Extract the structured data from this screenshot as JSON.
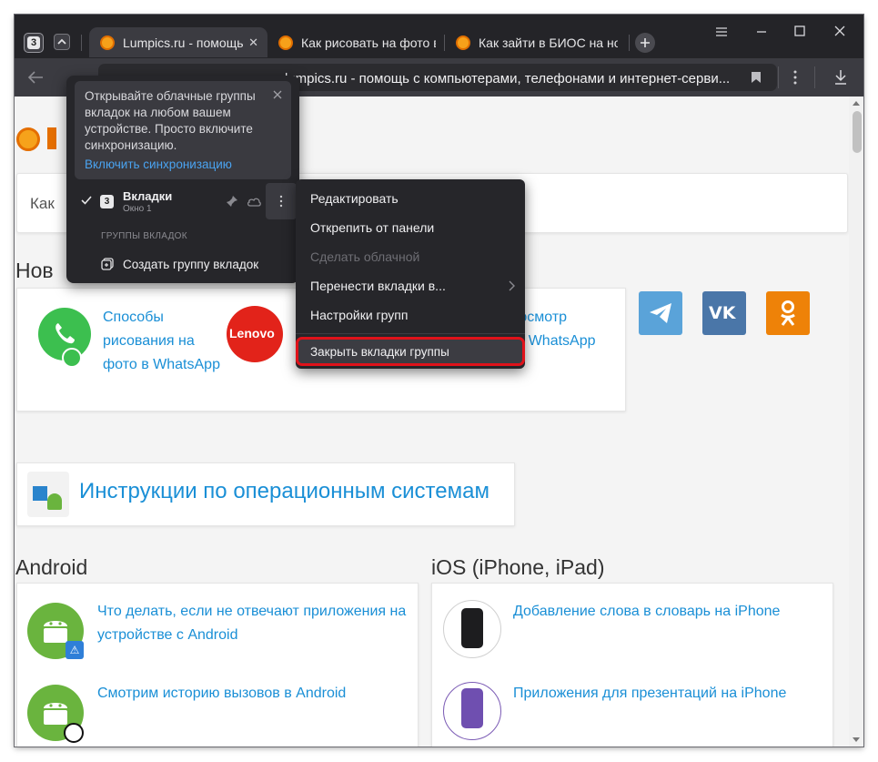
{
  "browser": {
    "tab_count": "3",
    "tabs": [
      {
        "title": "Lumpics.ru - помощь с компьютерами"
      },
      {
        "title": "Как рисовать на фото в WhatsApp"
      },
      {
        "title": "Как зайти в БИОС на ноутбуке"
      }
    ],
    "address": "lumpics.ru - помощь с компьютерами, телефонами и интернет-серви..."
  },
  "sync_popover": {
    "message": "Открывайте облачные группы вкладок на любом вашем устройстве. Просто включите синхронизацию.",
    "link": "Включить синхронизацию"
  },
  "tab_group": {
    "name": "Вкладки",
    "count": "3",
    "window": "Окно 1",
    "section_label": "ГРУППЫ ВКЛАДОК",
    "create_label": "Создать группу вкладок"
  },
  "context_menu": {
    "items": [
      {
        "label": "Редактировать",
        "enabled": true
      },
      {
        "label": "Открепить от панели",
        "enabled": true
      },
      {
        "label": "Сделать облачной",
        "enabled": false
      },
      {
        "label": "Перенести вкладки в...",
        "enabled": true,
        "submenu": true
      },
      {
        "label": "Настройки групп",
        "enabled": true
      }
    ],
    "close_group": "Закрыть вкладки группы",
    "highlight_color": "#e0121a"
  },
  "page": {
    "search_placeholder_partial": "Как",
    "new_heading_partial": "Нов",
    "articles_top": [
      {
        "title": "Способы рисования на фото в WhatsApp"
      },
      {
        "title": "...ткрытие и ...осмотр ...збранного» в WhatsApp"
      }
    ],
    "lenovo_logo": "Lenovo",
    "social": [
      "Telegram",
      "VK",
      "Одноклассники"
    ],
    "os_section": "Инструкции по операционным системам",
    "android": {
      "heading": "Android",
      "items": [
        {
          "title": "Что делать, если не отвечают приложения на устройстве с Android"
        },
        {
          "title": "Смотрим историю вызовов в Android"
        }
      ]
    },
    "ios": {
      "heading": "iOS (iPhone, iPad)",
      "items": [
        {
          "title": "Добавление слова в словарь на iPhone"
        },
        {
          "title": "Приложения для презентаций на iPhone"
        }
      ]
    }
  },
  "colors": {
    "accent_link": "#1a8fd6",
    "telegram": "#5aa3d9",
    "vk": "#4a76a8",
    "ok": "#ee8208",
    "android_green": "#6ab43e"
  }
}
